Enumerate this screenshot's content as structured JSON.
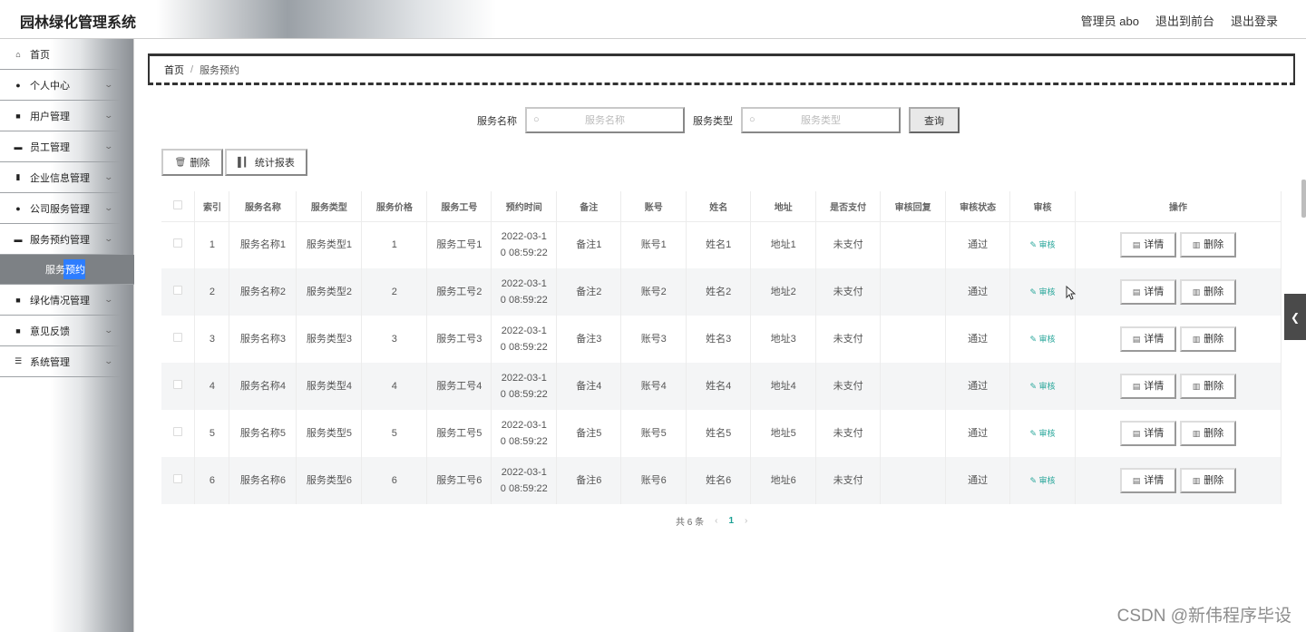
{
  "header": {
    "title": "园林绿化管理系统",
    "admin": "管理员 abo",
    "front": "退出到前台",
    "logout": "退出登录"
  },
  "sidebar": {
    "items": [
      {
        "label": "首页",
        "icon": "home-icon",
        "glyph": "⌂",
        "chevron": false
      },
      {
        "label": "个人中心",
        "icon": "user-icon",
        "glyph": "●",
        "chevron": true
      },
      {
        "label": "用户管理",
        "icon": "grid-icon",
        "glyph": "■",
        "chevron": true
      },
      {
        "label": "员工管理",
        "icon": "briefcase-icon",
        "glyph": "▬",
        "chevron": true
      },
      {
        "label": "企业信息管理",
        "icon": "doc-icon",
        "glyph": "▮",
        "chevron": true
      },
      {
        "label": "公司服务管理",
        "icon": "bulb-icon",
        "glyph": "●",
        "chevron": true
      },
      {
        "label": "服务预约管理",
        "icon": "monitor-icon",
        "glyph": "▬",
        "chevron": true
      },
      {
        "label": "服务预约",
        "sub": true
      },
      {
        "label": "绿化情况管理",
        "icon": "grid-icon",
        "glyph": "■",
        "chevron": true
      },
      {
        "label": "意见反馈",
        "icon": "grid-icon",
        "glyph": "■",
        "chevron": true
      },
      {
        "label": "系统管理",
        "icon": "list-icon",
        "glyph": "☰",
        "chevron": true
      }
    ]
  },
  "breadcrumb": {
    "home": "首页",
    "sep": "/",
    "current": "服务预约"
  },
  "search": {
    "name_label": "服务名称",
    "name_placeholder": "服务名称",
    "type_label": "服务类型",
    "type_placeholder": "服务类型",
    "query": "查询"
  },
  "actions": {
    "delete": "删除",
    "stats": "统计报表"
  },
  "table": {
    "headers": [
      "索引",
      "服务名称",
      "服务类型",
      "服务价格",
      "服务工号",
      "预约时间",
      "备注",
      "账号",
      "姓名",
      "地址",
      "是否支付",
      "审核回复",
      "审核状态",
      "审核",
      "操作"
    ],
    "rows": [
      {
        "idx": "1",
        "name": "服务名称1",
        "type": "服务类型1",
        "price": "1",
        "no": "服务工号1",
        "time1": "2022-03-1",
        "time2": "0 08:59:22",
        "note": "备注1",
        "account": "账号1",
        "person": "姓名1",
        "addr": "地址1",
        "paid": "未支付",
        "reply": "",
        "status": "通过",
        "audit": "审核",
        "detail": "详情",
        "del": "删除"
      },
      {
        "idx": "2",
        "name": "服务名称2",
        "type": "服务类型2",
        "price": "2",
        "no": "服务工号2",
        "time1": "2022-03-1",
        "time2": "0 08:59:22",
        "note": "备注2",
        "account": "账号2",
        "person": "姓名2",
        "addr": "地址2",
        "paid": "未支付",
        "reply": "",
        "status": "通过",
        "audit": "审核",
        "detail": "详情",
        "del": "删除"
      },
      {
        "idx": "3",
        "name": "服务名称3",
        "type": "服务类型3",
        "price": "3",
        "no": "服务工号3",
        "time1": "2022-03-1",
        "time2": "0 08:59:22",
        "note": "备注3",
        "account": "账号3",
        "person": "姓名3",
        "addr": "地址3",
        "paid": "未支付",
        "reply": "",
        "status": "通过",
        "audit": "审核",
        "detail": "详情",
        "del": "删除"
      },
      {
        "idx": "4",
        "name": "服务名称4",
        "type": "服务类型4",
        "price": "4",
        "no": "服务工号4",
        "time1": "2022-03-1",
        "time2": "0 08:59:22",
        "note": "备注4",
        "account": "账号4",
        "person": "姓名4",
        "addr": "地址4",
        "paid": "未支付",
        "reply": "",
        "status": "通过",
        "audit": "审核",
        "detail": "详情",
        "del": "删除"
      },
      {
        "idx": "5",
        "name": "服务名称5",
        "type": "服务类型5",
        "price": "5",
        "no": "服务工号5",
        "time1": "2022-03-1",
        "time2": "0 08:59:22",
        "note": "备注5",
        "account": "账号5",
        "person": "姓名5",
        "addr": "地址5",
        "paid": "未支付",
        "reply": "",
        "status": "通过",
        "audit": "审核",
        "detail": "详情",
        "del": "删除"
      },
      {
        "idx": "6",
        "name": "服务名称6",
        "type": "服务类型6",
        "price": "6",
        "no": "服务工号6",
        "time1": "2022-03-1",
        "time2": "0 08:59:22",
        "note": "备注6",
        "account": "账号6",
        "person": "姓名6",
        "addr": "地址6",
        "paid": "未支付",
        "reply": "",
        "status": "通过",
        "audit": "审核",
        "detail": "详情",
        "del": "删除"
      }
    ]
  },
  "pagination": {
    "total": "共 6 条",
    "prev": "‹",
    "current": "1",
    "next": "›"
  },
  "watermark": "CSDN @新伟程序毕设",
  "colors": {
    "accent_teal": "#1aa094",
    "submenu_bg": "#7d8185",
    "active_blue": "#2d7dff"
  }
}
